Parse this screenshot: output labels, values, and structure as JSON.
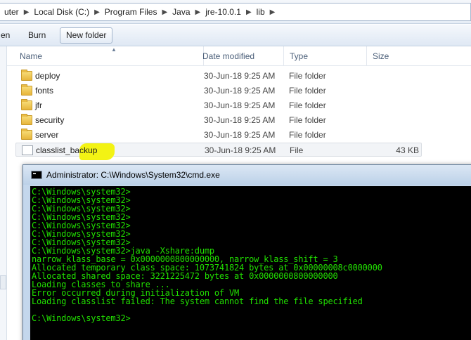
{
  "address": {
    "crumbs": [
      "uter",
      "Local Disk (C:)",
      "Program Files",
      "Java",
      "jre-10.0.1",
      "lib"
    ]
  },
  "toolbar": {
    "open_label": "en",
    "burn_label": "Burn",
    "new_folder_label": "New folder"
  },
  "columns": {
    "name": "Name",
    "date": "Date modified",
    "type": "Type",
    "size": "Size"
  },
  "files": [
    {
      "name": "deploy",
      "date": "30-Jun-18 9:25 AM",
      "type": "File folder",
      "size": "",
      "icon": "folder-icon"
    },
    {
      "name": "fonts",
      "date": "30-Jun-18 9:25 AM",
      "type": "File folder",
      "size": "",
      "icon": "folder-icon"
    },
    {
      "name": "jfr",
      "date": "30-Jun-18 9:25 AM",
      "type": "File folder",
      "size": "",
      "icon": "folder-icon"
    },
    {
      "name": "security",
      "date": "30-Jun-18 9:25 AM",
      "type": "File folder",
      "size": "",
      "icon": "folder-icon"
    },
    {
      "name": "server",
      "date": "30-Jun-18 9:25 AM",
      "type": "File folder",
      "size": "",
      "icon": "folder-icon"
    },
    {
      "name_prefix": "classlist",
      "name_suffix": "_backup",
      "date": "30-Jun-18 9:25 AM",
      "type": "File",
      "size": "43 KB",
      "icon": "file-icon"
    }
  ],
  "cmd": {
    "title": "Administrator: C:\\Windows\\System32\\cmd.exe",
    "lines": [
      "C:\\Windows\\system32>",
      "C:\\Windows\\system32>",
      "C:\\Windows\\system32>",
      "C:\\Windows\\system32>",
      "C:\\Windows\\system32>",
      "C:\\Windows\\system32>",
      "C:\\Windows\\system32>",
      "C:\\Windows\\system32>java -Xshare:dump",
      "narrow_klass_base = 0x0000000800000000, narrow_klass_shift = 3",
      "Allocated temporary class space: 1073741824 bytes at 0x00000008c0000000",
      "Allocated shared space: 3221225472 bytes at 0x0000000800000000",
      "Loading classes to share ...",
      "Error occurred during initialization of VM",
      "Loading classlist failed: The system cannot find the file specified",
      "",
      "C:\\Windows\\system32>"
    ]
  },
  "colors": {
    "console_text": "#21e000",
    "console_bg": "#000000",
    "highlight": "#f5f50c"
  }
}
